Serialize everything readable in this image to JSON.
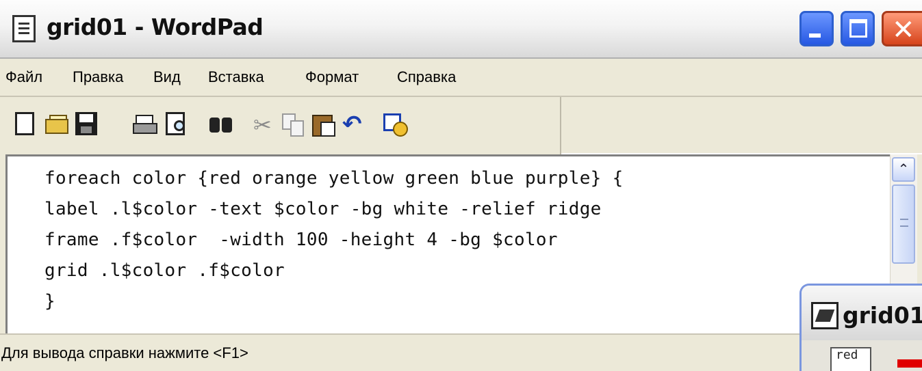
{
  "window": {
    "title": "grid01 - WordPad",
    "close_glyph": "✕"
  },
  "menubar": {
    "items": [
      "Файл",
      "Правка",
      "Вид",
      "Вставка",
      "Формат",
      "Справка"
    ]
  },
  "toolbar": {
    "icons": [
      "new-icon",
      "open-icon",
      "save-icon",
      "print-icon",
      "print-preview-icon",
      "find-icon",
      "cut-icon",
      "copy-icon",
      "paste-icon",
      "undo-icon",
      "date-time-icon"
    ],
    "cut_glyph": "✂",
    "undo_glyph": "↶"
  },
  "editor": {
    "lines": [
      "foreach color {red orange yellow green blue purple} {",
      "label .l$color -text $color -bg white -relief ridge",
      "frame .f$color  -width 100 -height 4 -bg $color",
      "grid .l$color .f$color",
      "}"
    ]
  },
  "scrollbar": {
    "up_glyph": "⌃"
  },
  "statusbar": {
    "text": "Для вывода справки нажмите <F1>"
  },
  "grid_window": {
    "title": "grid01",
    "label_text": "red"
  }
}
